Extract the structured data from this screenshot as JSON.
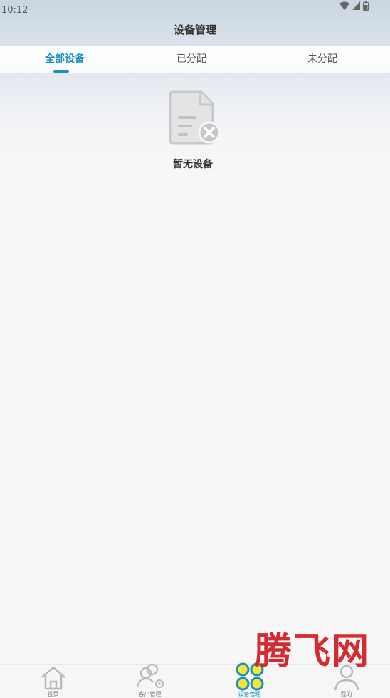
{
  "status_bar": {
    "time": "10:12"
  },
  "header": {
    "title": "设备管理"
  },
  "tabs": [
    {
      "label": "全部设备",
      "active": true
    },
    {
      "label": "已分配",
      "active": false
    },
    {
      "label": "未分配",
      "active": false
    }
  ],
  "empty_state": {
    "icon": "file-error-icon",
    "text": "暂无设备"
  },
  "bottom_nav": [
    {
      "label": "首页",
      "icon": "home-icon",
      "active": false
    },
    {
      "label": "客户管理",
      "icon": "customer-icon",
      "active": false
    },
    {
      "label": "设备管理",
      "icon": "device-grid-icon",
      "active": true
    },
    {
      "label": "我的",
      "icon": "user-icon",
      "active": false
    }
  ],
  "watermark": {
    "text": "腾飞网"
  },
  "colors": {
    "accent": "#1e8fbf",
    "device_dot_yellow": "#f2e63a",
    "device_dot_blue": "#1e8fbf",
    "watermark": "#d42a32"
  }
}
